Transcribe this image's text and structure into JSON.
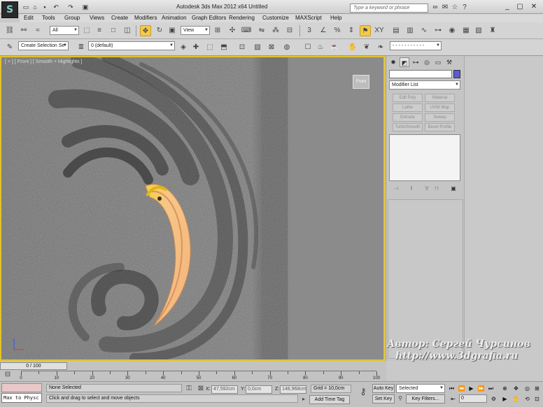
{
  "window": {
    "title": "Autodesk 3ds Max 2012 x64      Untitled",
    "search_placeholder": "Type a keyword or phrase",
    "logo": "3ds-max-logo"
  },
  "menu": [
    "Edit",
    "Tools",
    "Group",
    "Views",
    "Create",
    "Modifiers",
    "Animation",
    "Graph Editors",
    "Rendering",
    "Customize",
    "MAXScript",
    "Help"
  ],
  "toolbar": {
    "selection_filter": "All",
    "reference_coord": "View",
    "named_selection_placeholder": "Create Selection Se",
    "layer": "0 (default)"
  },
  "viewport": {
    "label": "[ + ] [ Front ] [ Smooth + Highlights ]",
    "viewcube_label": "Front",
    "border_color": "#e3c327",
    "object_color": "#f2b57a"
  },
  "command_panel": {
    "modifier_list": "Modifier List",
    "modifier_buttons": [
      "Edit Poly",
      "Material",
      "Lathe",
      "UVW Map",
      "Extrude",
      "Sweep",
      "TurboSmooth",
      "Bevel Profile"
    ],
    "object_color": "#5b5bd6"
  },
  "timeline": {
    "slider": "0 / 100",
    "ticks": [
      "0",
      "10",
      "20",
      "30",
      "40",
      "50",
      "60",
      "70",
      "80",
      "90",
      "100"
    ]
  },
  "status": {
    "script_text": "Max to Physc",
    "selection": "None Selected",
    "prompt": "Click and drag to select and move objects",
    "x": "47,592cm",
    "y": "0,0cm",
    "z": "148,968cm",
    "grid": "Grid = 10,0cm",
    "add_time_tag": "Add Time Tag",
    "auto_key": "Auto Key",
    "set_key": "Set Key",
    "key_mode": "Selected",
    "key_filters": "Key Filters...",
    "frame": "0"
  },
  "watermark": {
    "line1": "Автор: Сергей Чурсинов",
    "line2": "http://www.3dgrafia.ru"
  }
}
